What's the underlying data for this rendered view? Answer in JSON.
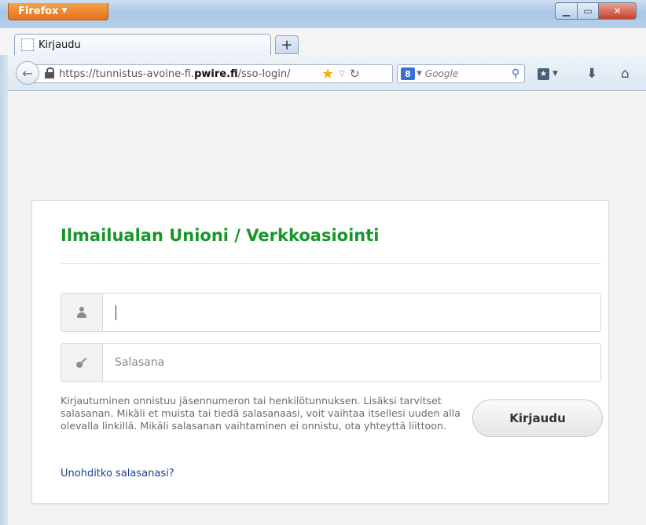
{
  "browser": {
    "menu_label": "Firefox",
    "tab_title": "Kirjaudu",
    "new_tab_label": "+",
    "url_prefix": "https://tunnistus-avoine-fi.",
    "url_host": "pwire.fi",
    "url_path": "/sso-login/",
    "search_engine_badge": "8",
    "search_placeholder": "Google"
  },
  "login": {
    "title": "Ilmailualan Unioni / Verkkoasiointi",
    "username_value": "",
    "password_placeholder": "Salasana",
    "help_text": "Kirjautuminen onnistuu jäsennumeron tai henkilötunnuksen. Lisäksi tarvitset salasanan. Mikäli et muista tai tiedä salasanaasi, voit vaihtaa itsellesi uuden alla olevalla linkillä. Mikäli salasanan vaihtaminen ei onnistu, ota yhteyttä liittoon.",
    "submit_label": "Kirjaudu",
    "forgot_link": "Unohditko salasanasi?"
  },
  "colors": {
    "title_green": "#17962a",
    "link_blue": "#1d3f8a",
    "firefox_orange": "#e6701b"
  }
}
